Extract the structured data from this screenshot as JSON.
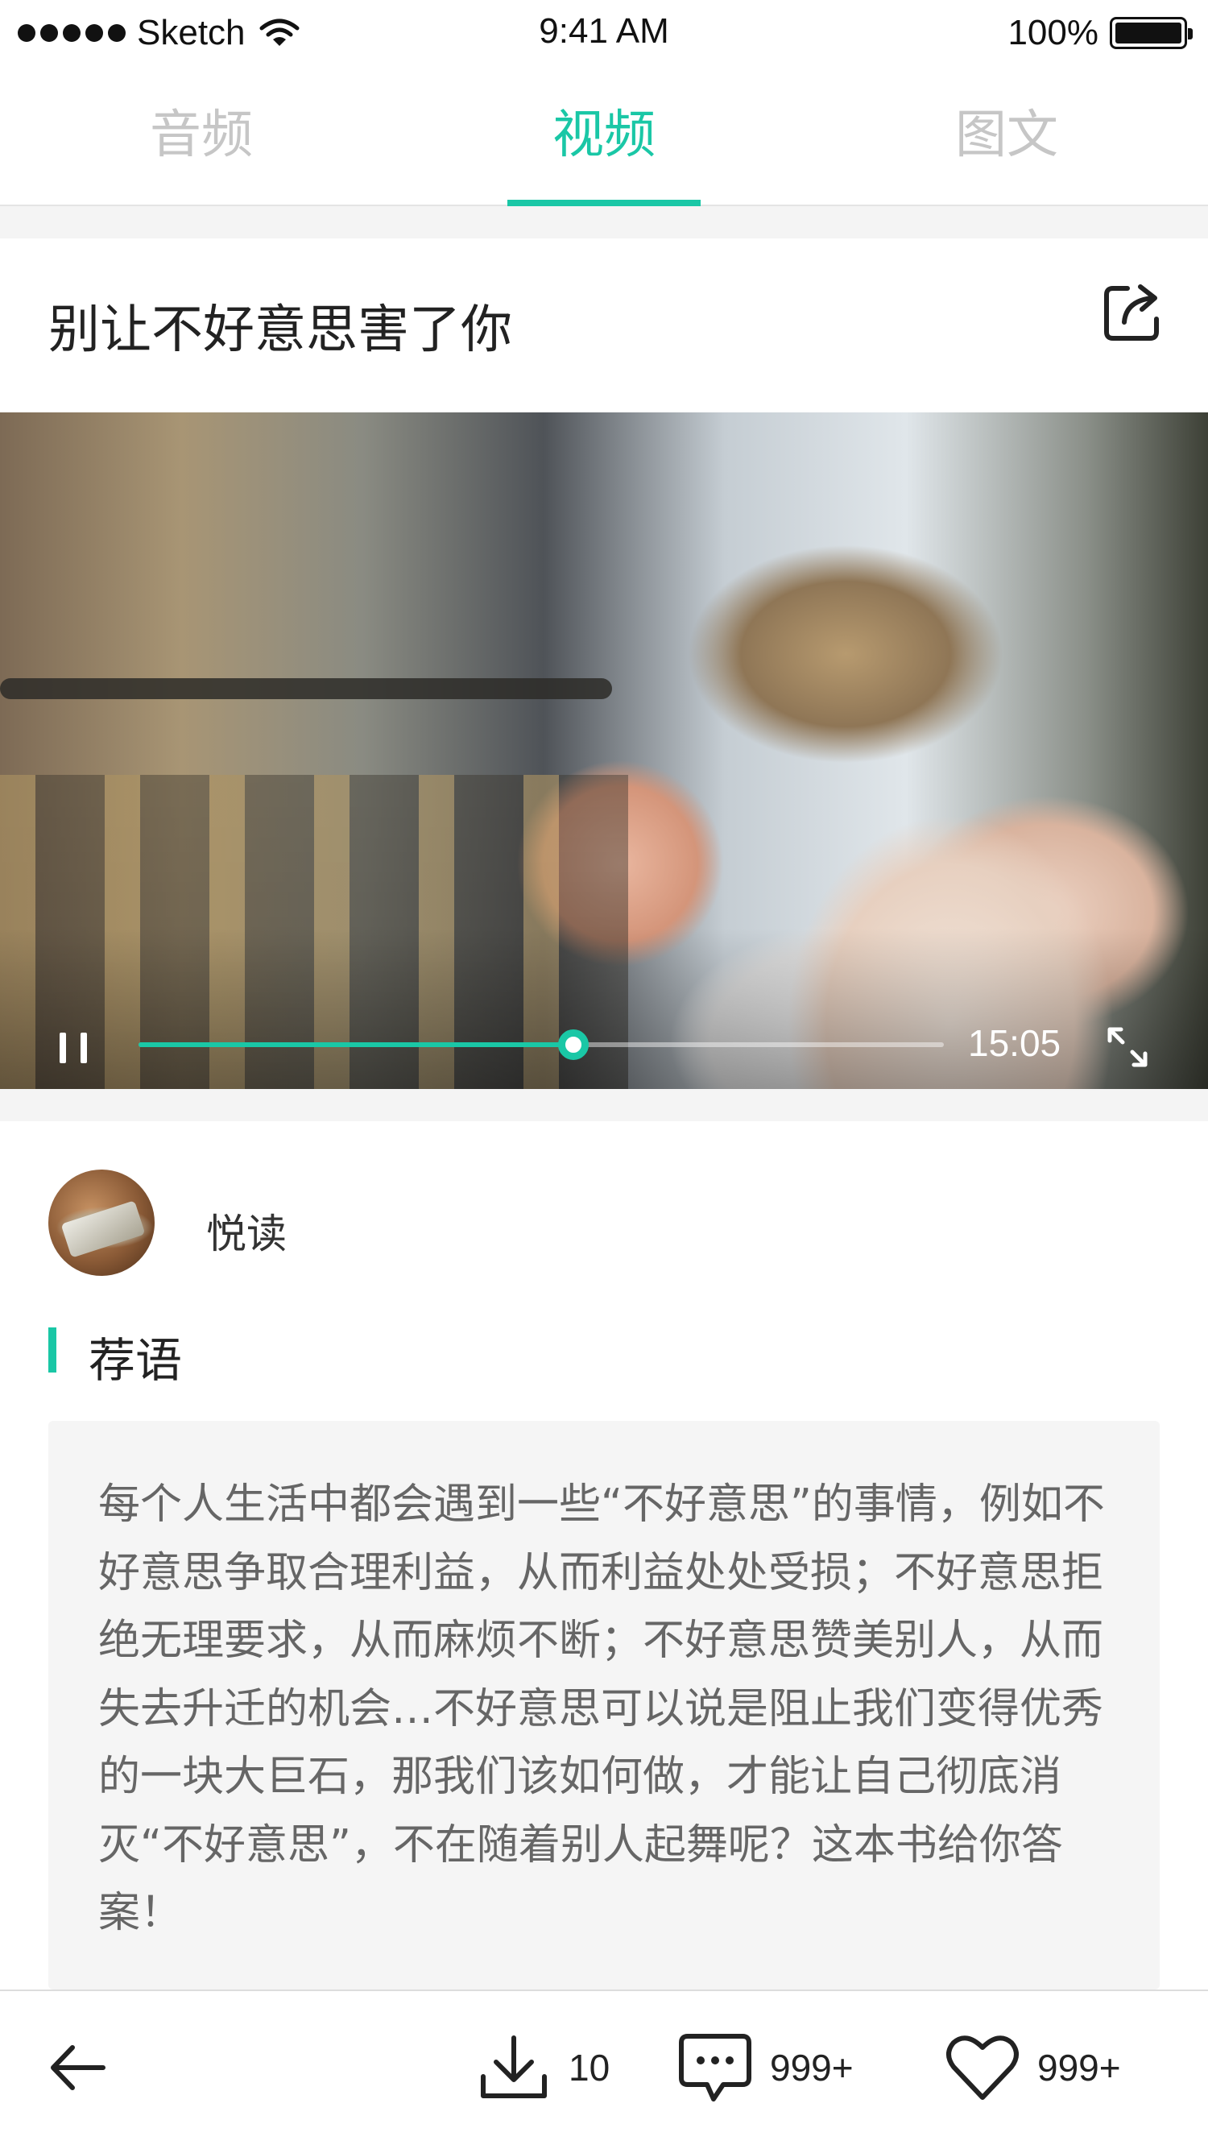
{
  "status_bar": {
    "carrier": "Sketch",
    "time": "9:41 AM",
    "battery": "100%"
  },
  "tabs": [
    {
      "label": "音频",
      "active": false
    },
    {
      "label": "视频",
      "active": true
    },
    {
      "label": "图文",
      "active": false
    }
  ],
  "article": {
    "title": "别让不好意思害了你"
  },
  "player": {
    "duration": "15:05",
    "progress": 0.54
  },
  "author": {
    "name": "悦读"
  },
  "section": {
    "title": "荐语",
    "text": "每个人生活中都会遇到一些“不好意思”的事情，例如不好意思争取合理利益，从而利益处处受损；不好意思拒绝无理要求，从而麻烦不断；不好意思赞美别人，从而失去升迁的机会…不好意思可以说是阻止我们变得优秀的一块大巨石，那我们该如何做，才能让自己彻底消灭“不好意思”，不在随着别人起舞呢？这本书给你答案！"
  },
  "bottom_bar": {
    "download_count": "10",
    "comment_count": "999+",
    "like_count": "999+"
  },
  "colors": {
    "accent": "#1ac7a6",
    "tab_inactive": "#c6c6c6",
    "text_secondary": "#666666"
  },
  "icons": {
    "share": "share-icon",
    "pause": "pause-icon",
    "fullscreen": "fullscreen-icon",
    "back": "back-arrow-icon",
    "download": "download-icon",
    "comment": "comment-icon",
    "like": "heart-icon"
  }
}
